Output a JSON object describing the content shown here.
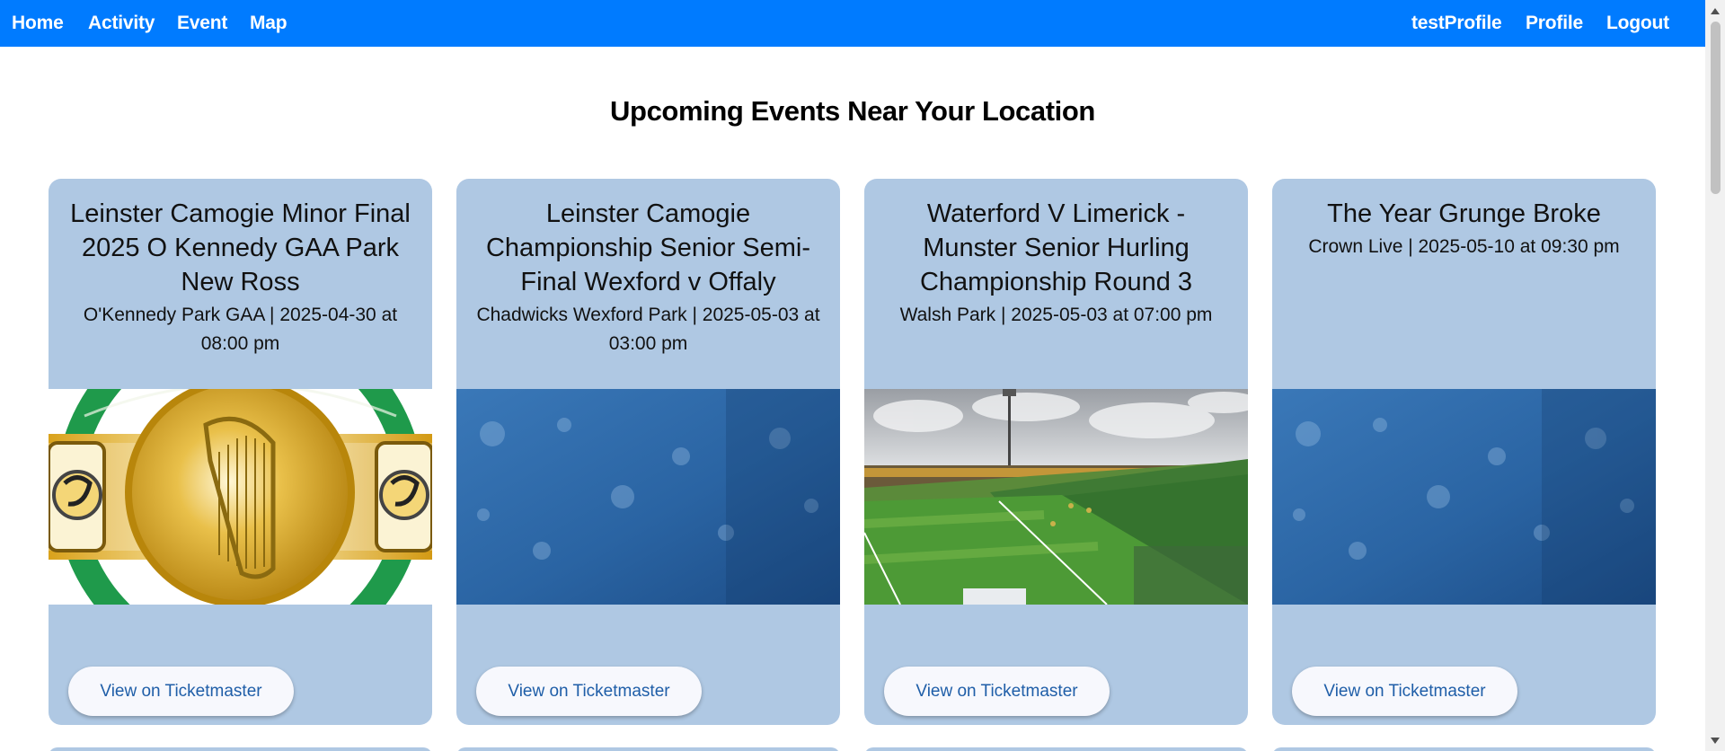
{
  "nav": {
    "left": [
      {
        "label": "Home"
      },
      {
        "label": "Activity"
      },
      {
        "label": "Event"
      },
      {
        "label": "Map"
      }
    ],
    "right": [
      {
        "label": "testProfile"
      },
      {
        "label": "Profile"
      },
      {
        "label": "Logout"
      }
    ]
  },
  "page": {
    "title": "Upcoming Events Near Your Location"
  },
  "events": [
    {
      "title": "Leinster Camogie Minor Final 2025 O Kennedy GAA Park New Ross",
      "meta": "O'Kennedy Park GAA | 2025-04-30 at 08:00 pm",
      "image": "camogie-association-logo",
      "button": "View on Ticketmaster"
    },
    {
      "title": "Leinster Camogie Championship Senior Semi-Final Wexford v Offaly",
      "meta": "Chadwicks Wexford Park | 2025-05-03 at 03:00 pm",
      "image": "blue-bokeh-placeholder",
      "button": "View on Ticketmaster"
    },
    {
      "title": "Waterford V Limerick - Munster Senior Hurling Championship Round 3",
      "meta": "Walsh Park | 2025-05-03 at 07:00 pm",
      "image": "stadium-crowd-photo",
      "button": "View on Ticketmaster"
    },
    {
      "title": "The Year Grunge Broke",
      "meta": "Crown Live | 2025-05-10 at 09:30 pm",
      "image": "blue-bokeh-placeholder",
      "button": "View on Ticketmaster"
    }
  ],
  "colors": {
    "navbar": "#007bff",
    "card": "#afc8e3",
    "button_text": "#1f5ea8"
  }
}
